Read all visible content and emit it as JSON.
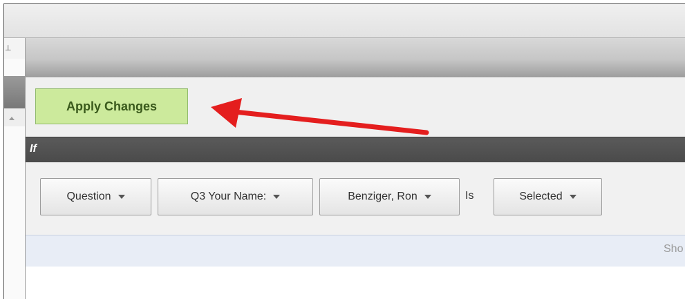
{
  "left_panel": {
    "glyph": "⊥"
  },
  "apply_button": {
    "label": "Apply Changes",
    "bg_color": "#ccea9c"
  },
  "if_bar": {
    "label": "If"
  },
  "condition": {
    "dropdowns": [
      {
        "value": "Question"
      },
      {
        "value": "Q3 Your Name:"
      },
      {
        "value": "Benziger, Ron"
      },
      {
        "value": "Selected"
      }
    ],
    "operator_label": "Is"
  },
  "info_band": {
    "text": "Sho"
  },
  "annotation": {
    "arrow_color": "#e41e1e"
  }
}
